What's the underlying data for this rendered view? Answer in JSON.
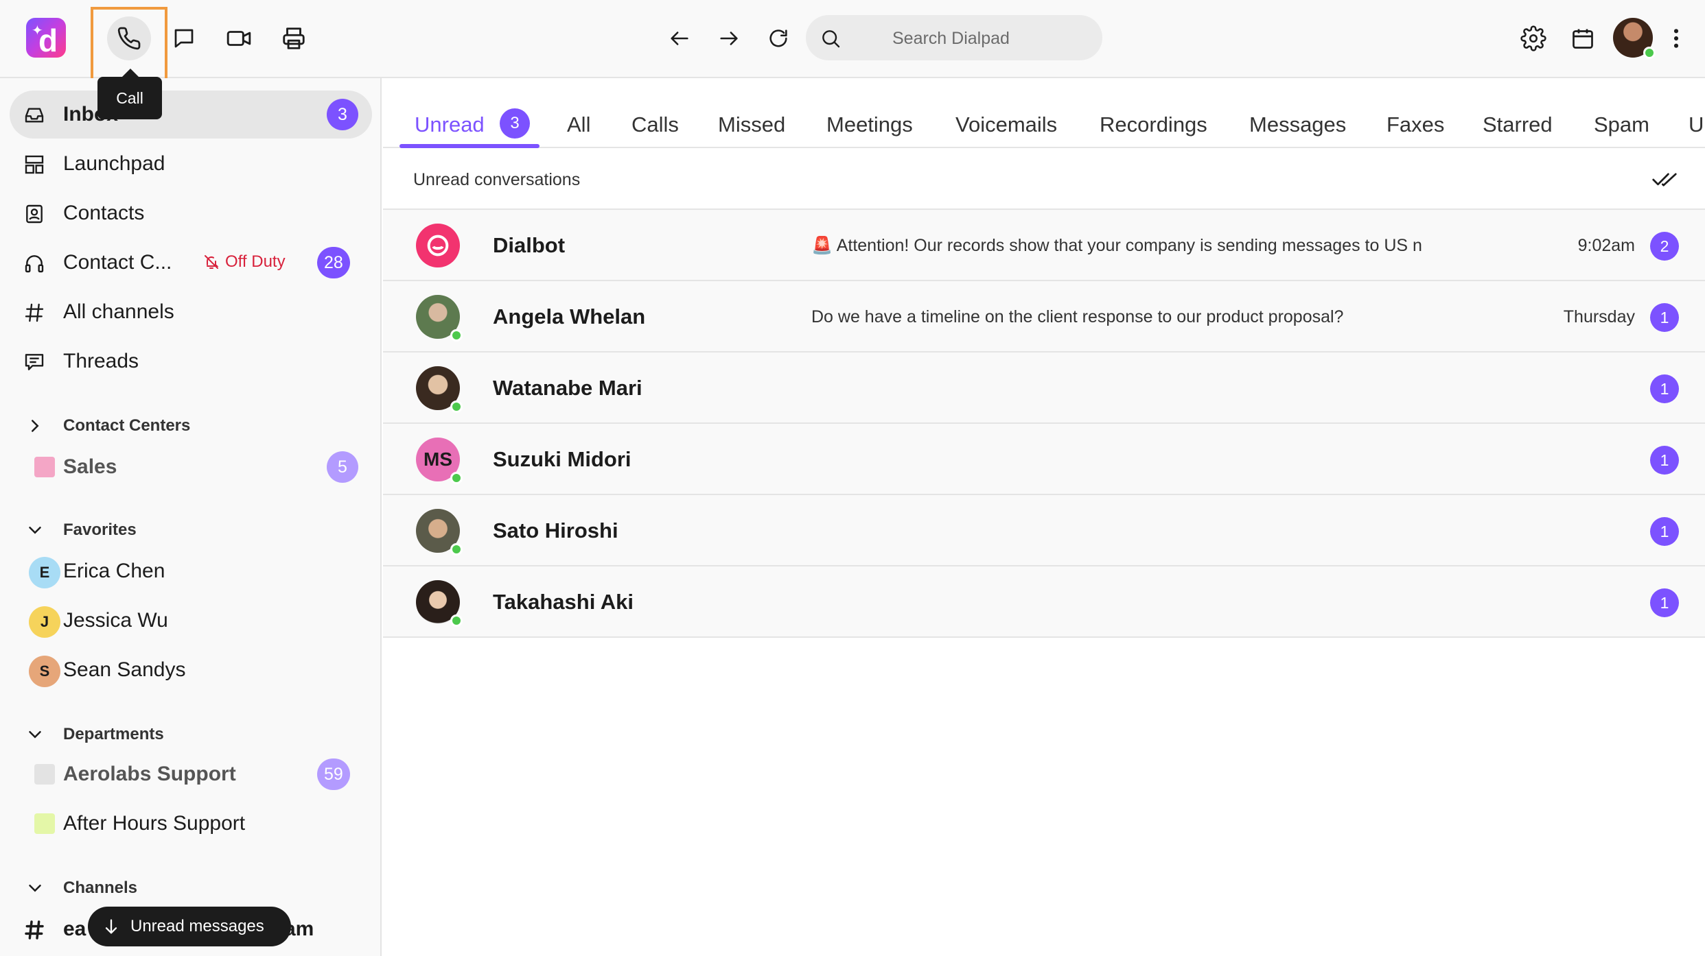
{
  "topbar": {
    "search_placeholder": "Search Dialpad",
    "tooltip": "Call",
    "logo_letter": "d"
  },
  "colors": {
    "accent": "#7c52ff",
    "danger": "#d8223c",
    "online": "#4cc94c",
    "highlight": "#f09a3e"
  },
  "sidebar": {
    "items": [
      {
        "label": "Inbox",
        "count": "3",
        "icon": "inbox-icon"
      },
      {
        "label": "Launchpad",
        "icon": "launchpad-icon"
      },
      {
        "label": "Contacts",
        "icon": "contacts-icon"
      },
      {
        "label": "Contact C...",
        "status": "Off Duty",
        "count": "28",
        "icon": "headset-icon"
      },
      {
        "label": "All channels",
        "icon": "hash-icon"
      },
      {
        "label": "Threads",
        "icon": "threads-icon"
      }
    ],
    "contact_centers": {
      "title": "Contact Centers",
      "items": [
        {
          "label": "Sales",
          "count": "5",
          "color": "#f4a6c6"
        }
      ]
    },
    "favorites": {
      "title": "Favorites",
      "items": [
        {
          "label": "Erica Chen",
          "initial": "E",
          "color": "#a8dcf5"
        },
        {
          "label": "Jessica Wu",
          "initial": "J",
          "color": "#f6d35b"
        },
        {
          "label": "Sean Sandys",
          "initial": "S",
          "color": "#e6a679"
        }
      ]
    },
    "departments": {
      "title": "Departments",
      "items": [
        {
          "label": "Aerolabs Support",
          "count": "59",
          "color": "#e3e3e3"
        },
        {
          "label": "After Hours Support",
          "color": "#e4f7a8"
        }
      ]
    },
    "channels": {
      "title": "Channels",
      "partial_left": "ea",
      "partial_right": "am"
    },
    "unread_pill": "Unread messages"
  },
  "main": {
    "tabs": [
      {
        "label": "Unread",
        "count": "3"
      },
      {
        "label": "All"
      },
      {
        "label": "Calls"
      },
      {
        "label": "Missed"
      },
      {
        "label": "Meetings"
      },
      {
        "label": "Voicemails"
      },
      {
        "label": "Recordings"
      },
      {
        "label": "Messages"
      },
      {
        "label": "Faxes"
      },
      {
        "label": "Starred"
      },
      {
        "label": "Spam"
      },
      {
        "label": "U"
      }
    ],
    "subheader": "Unread conversations",
    "conversations": [
      {
        "name": "Dialbot",
        "message": "🚨 Attention! Our records show that your company is sending messages to US n",
        "time": "9:02am",
        "count": "2"
      },
      {
        "name": "Angela Whelan",
        "message": "Do we have a timeline on the client response to our product proposal?",
        "time": "Thursday",
        "count": "1"
      },
      {
        "name": "Watanabe Mari",
        "message": "",
        "time": "",
        "count": "1"
      },
      {
        "name": "Suzuki Midori",
        "initials": "MS",
        "message": "",
        "time": "",
        "count": "1"
      },
      {
        "name": "Sato Hiroshi",
        "message": "",
        "time": "",
        "count": "1"
      },
      {
        "name": "Takahashi Aki",
        "message": "",
        "time": "",
        "count": "1"
      }
    ]
  }
}
